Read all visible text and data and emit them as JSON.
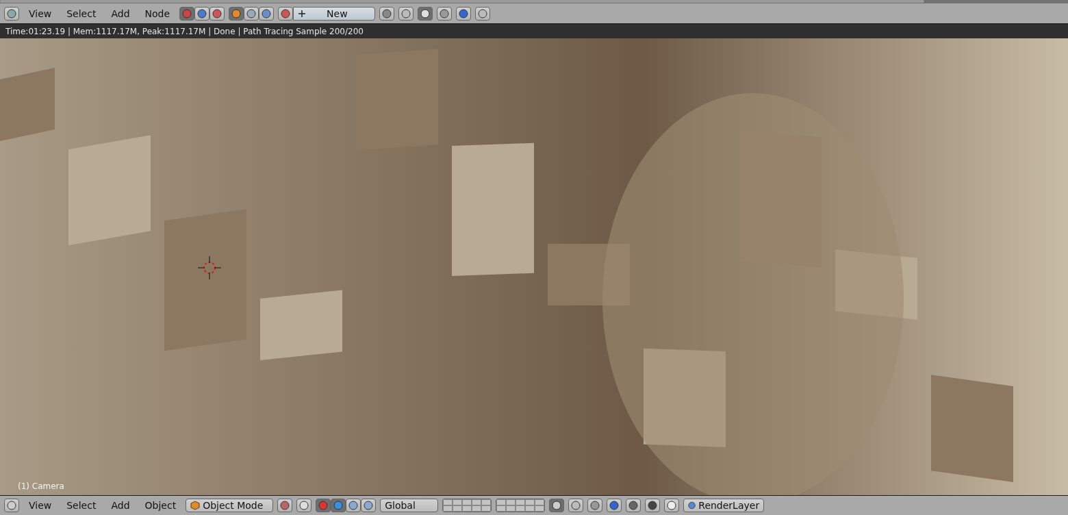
{
  "node_editor_header": {
    "menus": [
      "View",
      "Select",
      "Add",
      "Node"
    ],
    "tree_types": [
      {
        "selected": true
      },
      {
        "selected": false
      },
      {
        "selected": false
      }
    ],
    "shader_types": [
      {
        "selected": true
      },
      {
        "selected": false
      },
      {
        "selected": false
      }
    ],
    "material_new_button": "New"
  },
  "status": "Time:01:23.19 | Mem:1117.17M, Peak:1117.17M | Done | Path Tracing Sample 200/200",
  "viewport": {
    "kind": "picture",
    "object_label": "(1) Camera"
  },
  "view3d_header": {
    "menus": [
      "View",
      "Select",
      "Add",
      "Object"
    ],
    "mode": "Object Mode",
    "manipulators": [
      {
        "selected": true
      },
      {
        "selected": true
      },
      {
        "selected": false
      },
      {
        "selected": false
      }
    ],
    "orientation": "Global",
    "render_layer": "RenderLayer"
  }
}
